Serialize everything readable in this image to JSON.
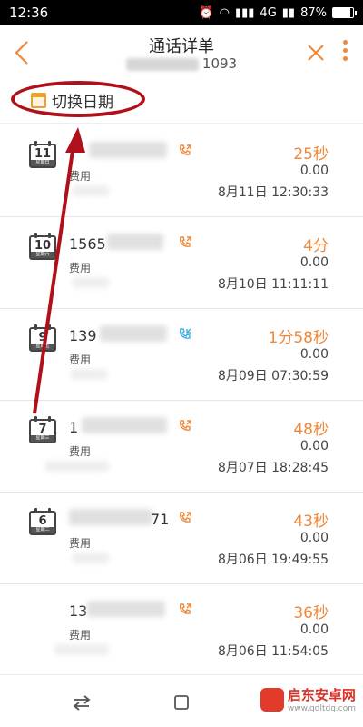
{
  "status_bar": {
    "time": "12:36",
    "network": "4G",
    "battery_percent": "87%",
    "battery_level": 0.87
  },
  "header": {
    "title": "通话详单",
    "subtitle_visible": "1093"
  },
  "switch_date": {
    "label": "切换日期"
  },
  "calls": [
    {
      "day": "11",
      "weekday": "星期日",
      "number_visible": "",
      "fee_label": "费用",
      "direction": "outgoing",
      "duration": "25秒",
      "cost": "0.00",
      "time": "8月11日  12:30:33"
    },
    {
      "day": "10",
      "weekday": "星期六",
      "number_visible": "1565",
      "fee_label": "费用",
      "direction": "outgoing",
      "duration": "4分",
      "cost": "0.00",
      "time": "8月10日  11:11:11"
    },
    {
      "day": "9",
      "weekday": "星期五",
      "number_visible": "139",
      "fee_label": "费用",
      "direction": "incoming",
      "duration": "1分58秒",
      "cost": "0.00",
      "time": "8月09日  07:30:59"
    },
    {
      "day": "7",
      "weekday": "星期三",
      "number_visible": "1",
      "fee_label": "费用",
      "direction": "outgoing",
      "duration": "48秒",
      "cost": "0.00",
      "time": "8月07日  18:28:45"
    },
    {
      "day": "6",
      "weekday": "星期二",
      "number_visible": "71",
      "fee_label": "费用",
      "direction": "outgoing",
      "duration": "43秒",
      "cost": "0.00",
      "time": "8月06日  19:49:55"
    },
    {
      "day": "",
      "weekday": "",
      "number_visible": "13",
      "fee_label": "费用",
      "direction": "outgoing",
      "duration": "36秒",
      "cost": "0.00",
      "time": "8月06日  11:54:05"
    }
  ],
  "watermark": {
    "title": "启东安卓网",
    "url": "www.qdltdq.com"
  },
  "colors": {
    "accent": "#f0883a",
    "incoming": "#3bb1e6",
    "highlight": "#b0101a"
  },
  "icons": {
    "back": "chevron-left-icon",
    "close": "close-icon",
    "more": "more-vertical-icon",
    "calendar": "calendar-icon",
    "outgoing": "phone-outgoing-icon",
    "incoming": "phone-incoming-icon",
    "nav_back": "swap-arrows-icon",
    "nav_home": "square-icon"
  }
}
